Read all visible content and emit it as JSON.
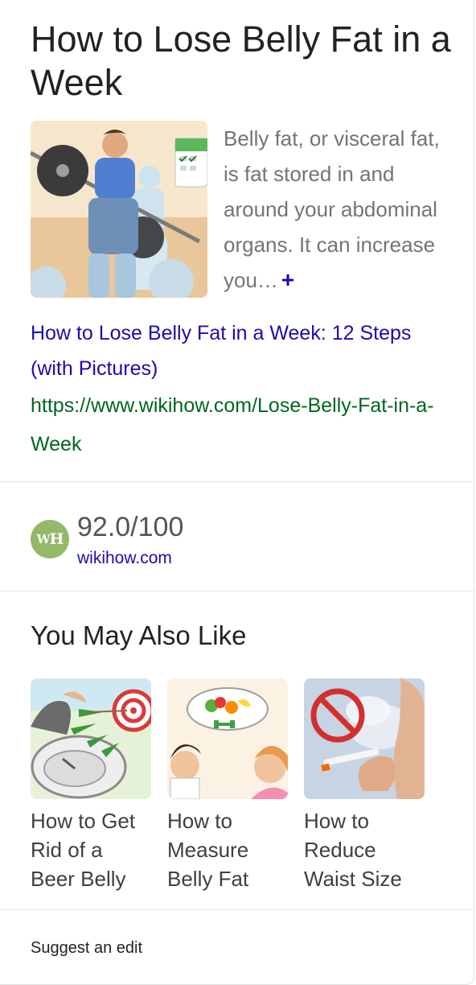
{
  "title": "How to Lose Belly Fat in a Week",
  "snippet": {
    "text": "Belly fat, or visceral fat, is fat stored in and around your abdominal organs. It can increase you…",
    "more_icon": "+"
  },
  "result": {
    "link_text": "How to Lose Belly Fat in a Week: 12 Steps (with Pictures)",
    "url": "https://www.wikihow.com/Lose-Belly-Fat-in-a-Week"
  },
  "rating": {
    "logo_text_w": "W",
    "logo_text_h": "H",
    "score": "92.0/100",
    "source": "wikihow.com"
  },
  "related": {
    "title": "You May Also Like",
    "items": [
      {
        "label": "How to Get Rid of a Beer Belly"
      },
      {
        "label": "How to Measure Belly Fat"
      },
      {
        "label": "How to Reduce Waist Size"
      }
    ]
  },
  "footer": {
    "suggest_edit": "Suggest an edit"
  },
  "colors": {
    "link": "#1a0dab",
    "url": "#006621",
    "snippet": "#70757a",
    "logo_bg": "#93b969"
  }
}
